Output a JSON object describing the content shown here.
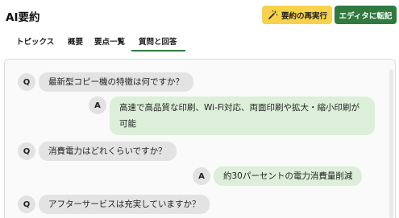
{
  "header": {
    "title": "AI要約",
    "rerun_label": "要約の再実行",
    "editor_label": "エディタに転記"
  },
  "tabs": [
    "トピックス",
    "概要",
    "要点一覧",
    "質問と回答"
  ],
  "active_tab": "質問と回答",
  "qa": {
    "q_mark": "Q",
    "a_mark": "A",
    "items": [
      {
        "q": "最新型コピー機の特徴は何ですか？",
        "a": "高速で高品質な印刷、Wi-Fi対応、両面印刷や拡大・縮小印刷が可能"
      },
      {
        "q": "消費電力はどれくらいですか？",
        "a": "約30パーセントの電力消費量削減"
      },
      {
        "q": "アフターサービスは充実していますか？"
      }
    ]
  },
  "colors": {
    "accent_green": "#2f7a3f",
    "rerun_yellow": "#f7d24a",
    "question_bubble": "#e3e3e3",
    "answer_bubble": "#dcefd9"
  },
  "icons": {
    "rerun": "magic-wand-icon"
  }
}
